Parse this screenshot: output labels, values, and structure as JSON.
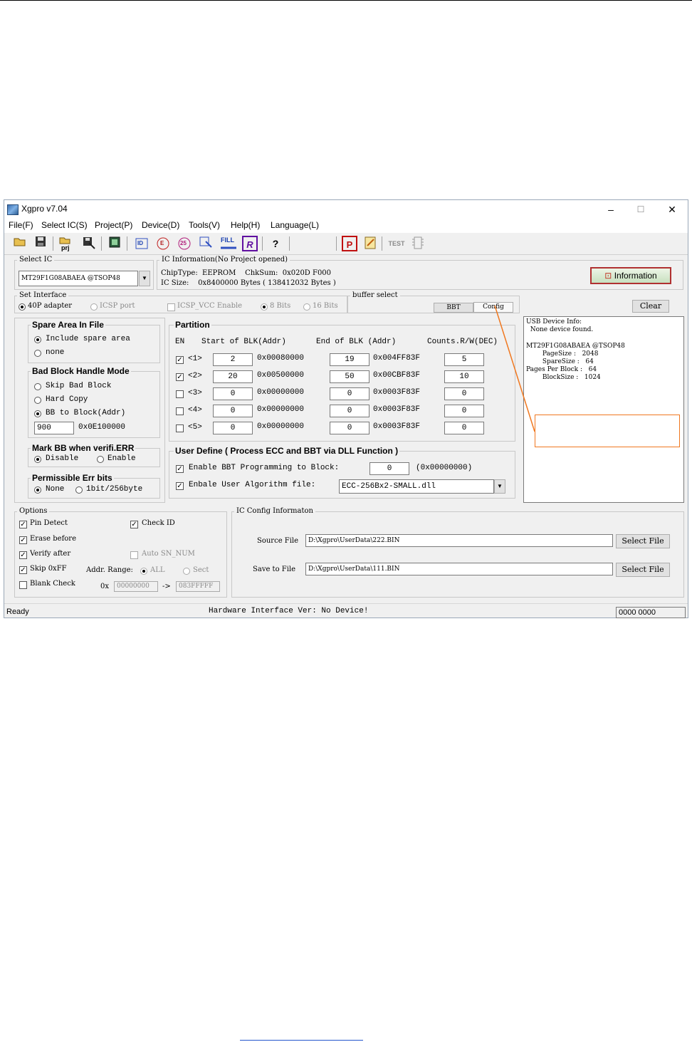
{
  "window": {
    "title": "Xgpro v7.04",
    "controls": {
      "minimize": "–",
      "maximize": "☐",
      "close": "✕"
    }
  },
  "menu": [
    "File(F)",
    "Select IC(S)",
    "Project(P)",
    "Device(D)",
    "Tools(V)",
    "Help(H)",
    "Language(L)"
  ],
  "toolbar": {
    "icons": [
      "open-icon",
      "save-icon",
      "open-project-icon",
      "save-project-icon",
      "chip-view-icon",
      "read-id-icon",
      "erase-icon",
      "crc-icon",
      "verify-icon",
      "fill-icon",
      "read-icon",
      "help-icon",
      "program-icon",
      "edit-icon",
      "test-icon",
      "pins-icon"
    ],
    "prj_label": "prj",
    "fill_label": "FILL",
    "r_label": "R",
    "id_label": "ID",
    "e_label": "E",
    "n25_label": "25",
    "help_label": "?",
    "p_label": "P",
    "test_label": "TEST"
  },
  "select_ic": {
    "group_label": "Select IC",
    "value": "MT29F1G08ABAEA @TSOP48",
    "dropdown_glyph": "▼"
  },
  "ic_info": {
    "group_label": "IC Information(No Project opened)",
    "line1": "ChipType:  EEPROM    ChkSum:  0x020D F000",
    "line2": "IC Size:    0x8400000 Bytes ( 138412032 Bytes )",
    "info_button": "Information"
  },
  "set_interface": {
    "group_label": "Set Interface",
    "adapter": "40P adapter",
    "icsp_port": "ICSP port",
    "icsp_vcc": "ICSP_VCC Enable",
    "bits8": "8 Bits",
    "bits16": "16 Bits"
  },
  "buffer_select": {
    "group_label": "buffer select",
    "bbt": "BBT",
    "config": "Config"
  },
  "clear_button": "Clear",
  "spare_area": {
    "title": "Spare Area In File",
    "include": "Include spare area",
    "none": "none"
  },
  "bad_block": {
    "title": "Bad Block Handle Mode",
    "skip": "Skip Bad Block",
    "hard_copy": "Hard Copy",
    "bb_to_block": "BB to Block(Addr)",
    "block_value": "900",
    "addr": "0x0E100000"
  },
  "mark_bb": {
    "title": "Mark BB when verifi.ERR",
    "disable": "Disable",
    "enable": "Enable"
  },
  "err_bits": {
    "title": "Permissible Err bits",
    "none": "None",
    "bit256": "1bit/256byte"
  },
  "partition": {
    "title": "Partition",
    "headers": [
      "EN",
      "Start of BLK(Addr)",
      "End of BLK (Addr)",
      "Counts.R/W(DEC)"
    ],
    "check_glyph": "✓",
    "rows": [
      {
        "label": "<1>",
        "checked": true,
        "start": "2",
        "start_addr": "0x00080000",
        "end": "19",
        "end_addr": "0x004FF83F",
        "count": "5"
      },
      {
        "label": "<2>",
        "checked": true,
        "start": "20",
        "start_addr": "0x00500000",
        "end": "50",
        "end_addr": "0x00CBF83F",
        "count": "10"
      },
      {
        "label": "<3>",
        "checked": false,
        "start": "0",
        "start_addr": "0x00000000",
        "end": "0",
        "end_addr": "0x0003F83F",
        "count": "0"
      },
      {
        "label": "<4>",
        "checked": false,
        "start": "0",
        "start_addr": "0x00000000",
        "end": "0",
        "end_addr": "0x0003F83F",
        "count": "0"
      },
      {
        "label": "<5>",
        "checked": false,
        "start": "0",
        "start_addr": "0x00000000",
        "end": "0",
        "end_addr": "0x0003F83F",
        "count": "0"
      }
    ]
  },
  "user_define": {
    "title": "User Define ( Process ECC and BBT via DLL Function )",
    "bbt_label": "Enable BBT Programming to Block:",
    "bbt_value": "0",
    "bbt_addr": "(0x00000000)",
    "algo_label": "Enbale User Algorithm file:",
    "algo_value": "ECC-256Bx2-SMALL.dll"
  },
  "device_info": {
    "lines": [
      "USB Device Info:",
      "  None device found.",
      "",
      "MT29F1G08ABAEA @TSOP48",
      "        PageSize :   2048",
      "        SpareSize :   64",
      "Pages Per Block :   64",
      "        BlockSize :   1024"
    ]
  },
  "options": {
    "group_label": "Options",
    "pin_detect": "Pin Detect",
    "check_id": "Check ID",
    "erase_before": "Erase before",
    "verify_after": "Verify after",
    "auto_sn": "Auto SN_NUM",
    "skip_ff": "Skip 0xFF",
    "addr_range": "Addr. Range:",
    "all": "ALL",
    "sect": "Sect",
    "blank_check": "Blank Check",
    "ox": "0x",
    "range_from": "00000000",
    "arrow": "->",
    "range_to": "083FFFFF"
  },
  "ic_config": {
    "group_label": "IC Config Informaton",
    "source_label": "Source File",
    "source_value": "D:\\Xgpro\\UserData\\222.BIN",
    "save_label": "Save to File",
    "save_value": "D:\\Xgpro\\UserData\\111.BIN",
    "select_file": "Select File"
  },
  "status": {
    "ready": "Ready",
    "hardware": "Hardware Interface Ver: No Device!",
    "counter": "0000 0000"
  },
  "colors": {
    "callout": "#f07820",
    "info_button_border": "#b03030",
    "window_bg": "#f0f0f0"
  }
}
